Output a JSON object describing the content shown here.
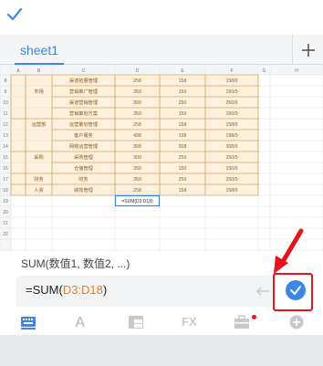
{
  "app": {
    "confirm_icon": "check-icon",
    "sheet_tab": "sheet1",
    "add_sheet_icon": "plus-icon"
  },
  "grid": {
    "column_headers": [
      "A",
      "B",
      "C",
      "D",
      "E",
      "F",
      "G",
      "H"
    ],
    "row_numbers": [
      "8",
      "9",
      "10",
      "11",
      "12",
      "13",
      "14",
      "15",
      "16",
      "17",
      "18",
      "19",
      "20",
      "21",
      "22"
    ],
    "rows": [
      [
        "",
        "",
        "渠道拓展管理",
        "258",
        "158",
        "158/0",
        ""
      ],
      [
        "",
        "市场",
        "营销推广管理",
        "350",
        "150",
        "150/0",
        ""
      ],
      [
        "",
        "",
        "渠道营销管理",
        "300",
        "250",
        "250/0",
        ""
      ],
      [
        "",
        "",
        "营销策划方案",
        "350",
        "150",
        "150/0",
        ""
      ],
      [
        "",
        "运营部",
        "运营策划管理",
        "258",
        "158",
        "158/0",
        ""
      ],
      [
        "",
        "",
        "客户服务",
        "498",
        "198",
        "198/0",
        ""
      ],
      [
        "",
        "",
        "网络运营管理",
        "308",
        "308",
        "308/0",
        ""
      ],
      [
        "",
        "采购",
        "采购管理",
        "300",
        "250",
        "250/0",
        ""
      ],
      [
        "",
        "",
        "仓储管理",
        "350",
        "150",
        "150/0",
        ""
      ],
      [
        "",
        "财务",
        "财务",
        "350",
        "250",
        "250/0",
        ""
      ],
      [
        "",
        "人资",
        "绩效管理",
        "258",
        "158",
        "158/0",
        ""
      ],
      [
        "",
        "",
        "",
        "=SUM(D3:D18)",
        "",
        "",
        ""
      ]
    ]
  },
  "function_hint": "SUM(数值1, 数值2, ...)",
  "formula": {
    "prefix": "=SUM(",
    "range": "D3:D18",
    "suffix": ")"
  },
  "toolbar": {
    "keyboard_icon": "keyboard-icon",
    "font_label": "A",
    "cell_icon": "cell-format-icon",
    "fx_label": "FX",
    "tool_icon": "toolbox-icon",
    "insert_icon": "plus-circle-icon"
  },
  "colors": {
    "accent": "#3b86e6",
    "highlight": "#e4141b",
    "table_fill": "#fdf0dd",
    "table_border": "#c98a2e",
    "selection": "#3b86e6"
  }
}
